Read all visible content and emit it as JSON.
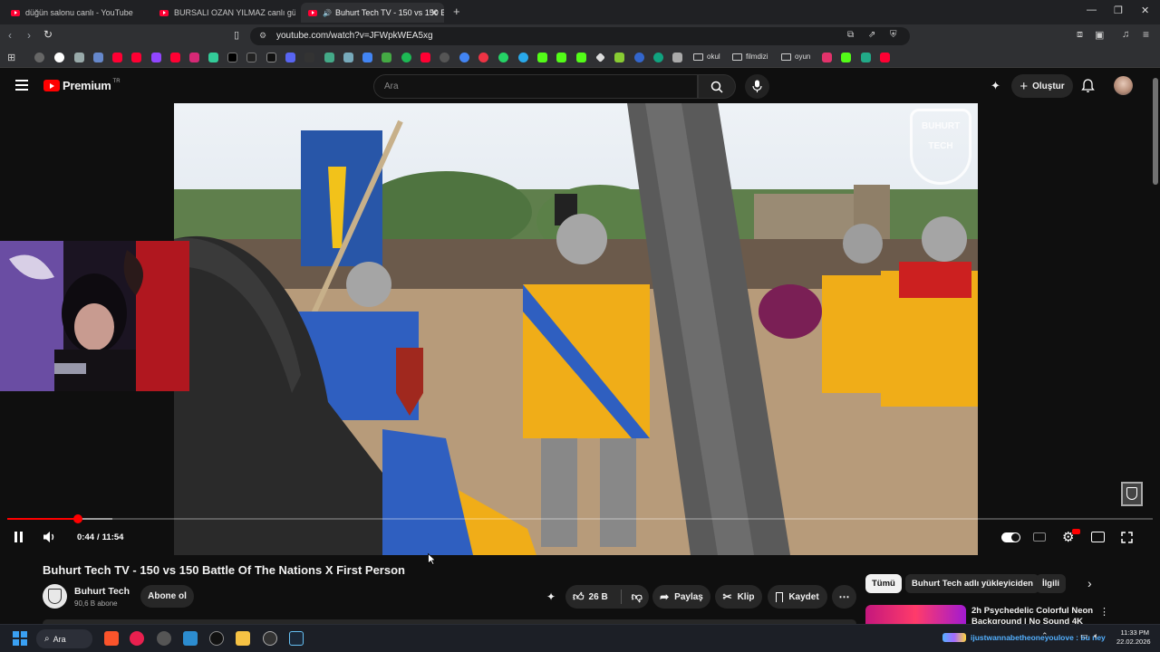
{
  "browser": {
    "tabs": [
      {
        "title": "düğün salonu canlı - YouTube",
        "active": false
      },
      {
        "title": "BURSALI OZAN YILMAZ canlı güvercin",
        "active": false
      },
      {
        "title": "Buhurt Tech TV - 150 vs 150 B",
        "active": true
      }
    ],
    "url": "youtube.com/watch?v=JFWpkWEA5xg",
    "bookmark_folders": [
      "okul",
      "filmdizi",
      "oyun"
    ]
  },
  "youtube": {
    "logo_text": "Premium",
    "logo_badge": "TR",
    "search_placeholder": "Ara",
    "create_label": "Oluştur",
    "watermark_text": "BUHURT TECH",
    "player": {
      "time_current": "0:44",
      "time_total": "11:54",
      "time_separator": "/",
      "progress_fraction": 0.0616,
      "buffer_fraction": 0.092
    },
    "video_title": "Buhurt Tech TV - 150 vs 150 Battle Of The Nations X First Person",
    "channel": {
      "name": "Buhurt Tech",
      "subscribers": "90,6 B abone",
      "subscribe_label": "Abone ol"
    },
    "actions": {
      "likes": "26 B",
      "share": "Paylaş",
      "clip": "Klip",
      "save": "Kaydet"
    },
    "chips": [
      "Tümü",
      "Buhurt Tech adlı yükleyiciden",
      "İlgili"
    ],
    "recommendation": {
      "title_line1": "2h Psychedelic Colorful Neon",
      "title_line2": "Background | No Sound 4K"
    }
  },
  "taskbar": {
    "search_label": "Ara",
    "chat_text": "ijustwannabetheoneyoulove : bu ney",
    "time": "11:33 PM",
    "date": "22.02.2026"
  },
  "colors": {
    "youtube_red": "#ff0000",
    "background": "#0f0f0f"
  }
}
